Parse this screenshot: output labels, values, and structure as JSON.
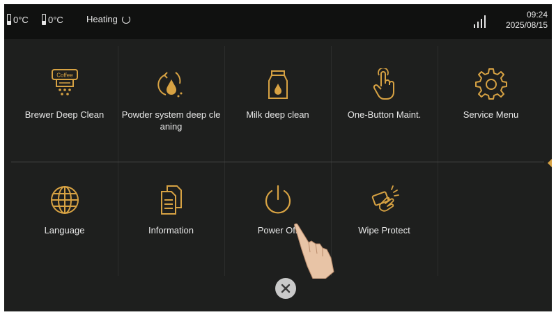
{
  "status": {
    "temp1": "0°C",
    "temp2": "0°C",
    "mode": "Heating",
    "time": "09:24",
    "date": "2025/08/15"
  },
  "accent_color": "#d7a243",
  "tiles": [
    {
      "label": "Brewer Deep Clean",
      "icon": "coffee-brewer-icon",
      "icon_text": "Coffee"
    },
    {
      "label": "Powder system deep cle aning",
      "icon": "powder-refresh-icon"
    },
    {
      "label": "Milk deep clean",
      "icon": "milk-carton-icon"
    },
    {
      "label": "One-Button Maint.",
      "icon": "touch-hand-icon"
    },
    {
      "label": "Service Menu",
      "icon": "gear-icon"
    },
    {
      "label": "Language",
      "icon": "globe-icon"
    },
    {
      "label": "Information",
      "icon": "documents-icon"
    },
    {
      "label": "Power Off",
      "icon": "power-icon"
    },
    {
      "label": "Wipe Protect",
      "icon": "wipe-hand-icon"
    }
  ]
}
